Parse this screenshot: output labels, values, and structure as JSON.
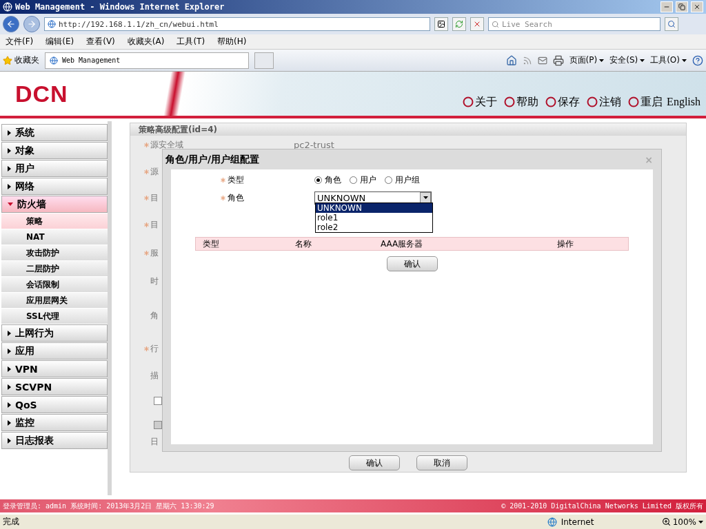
{
  "browser": {
    "title": "Web Management - Windows Internet Explorer",
    "address": "http://192.168.1.1/zh_cn/webui.html",
    "search_placeholder": "Live Search",
    "menu": [
      "文件(F)",
      "编辑(E)",
      "查看(V)",
      "收藏夹(A)",
      "工具(T)",
      "帮助(H)"
    ],
    "favorites": "收藏夹",
    "tab": "Web Management",
    "commands": [
      "页面(P)",
      "安全(S)",
      "工具(O)"
    ]
  },
  "header": {
    "logo": "DCN",
    "actions": [
      "关于",
      "帮助",
      "保存",
      "注销",
      "重启"
    ],
    "language": "English"
  },
  "sidebar": [
    {
      "label": "系统",
      "expanded": false
    },
    {
      "label": "对象",
      "expanded": false
    },
    {
      "label": "用户",
      "expanded": false
    },
    {
      "label": "网络",
      "expanded": false
    },
    {
      "label": "防火墙",
      "expanded": true,
      "children": [
        {
          "label": "策略",
          "selected": true
        },
        {
          "label": "NAT",
          "selected": false
        },
        {
          "label": "攻击防护",
          "selected": false
        },
        {
          "label": "二层防护",
          "selected": false
        },
        {
          "label": "会话限制",
          "selected": false
        },
        {
          "label": "应用层网关",
          "selected": false
        },
        {
          "label": "SSL代理",
          "selected": false
        }
      ]
    },
    {
      "label": "上网行为",
      "expanded": false
    },
    {
      "label": "应用",
      "expanded": false
    },
    {
      "label": "VPN",
      "expanded": false
    },
    {
      "label": "SCVPN",
      "expanded": false
    },
    {
      "label": "QoS",
      "expanded": false
    },
    {
      "label": "监控",
      "expanded": false
    },
    {
      "label": "日志报表",
      "expanded": false
    }
  ],
  "panel": {
    "title": "策略高级配置(id=4)",
    "fields": [
      {
        "kind": "text",
        "label": "源安全域",
        "required": true,
        "value": "pc2-trust"
      },
      {
        "kind": "text",
        "label": "源",
        "required": true
      },
      {
        "kind": "text",
        "label": "目",
        "required": true
      },
      {
        "kind": "text",
        "label": "目",
        "required": true
      },
      {
        "kind": "text",
        "label": "服",
        "required": true
      },
      {
        "kind": "text",
        "label": "时",
        "required": false
      },
      {
        "kind": "text",
        "label": "角",
        "required": false
      },
      {
        "kind": "text",
        "label": "行",
        "required": true
      },
      {
        "kind": "text",
        "label": "描",
        "required": false
      },
      {
        "kind": "checkbox",
        "checked": false,
        "disabled": false
      },
      {
        "kind": "checkbox",
        "checked": false,
        "disabled": true
      },
      {
        "kind": "text",
        "label": "日",
        "required": false
      }
    ],
    "buttons": [
      "确认",
      "取消"
    ]
  },
  "dialog": {
    "title": "角色/用户/用户组配置",
    "close": "×",
    "type_label": "类型",
    "type_options": [
      {
        "label": "角色",
        "selected": true
      },
      {
        "label": "用户",
        "selected": false
      },
      {
        "label": "用户组",
        "selected": false
      }
    ],
    "role_label": "角色",
    "role_value": "UNKNOWN",
    "role_options": [
      {
        "label": "UNKNOWN",
        "selected": true
      },
      {
        "label": "role1",
        "selected": false
      },
      {
        "label": "role2",
        "selected": false
      }
    ],
    "columns": [
      "类型",
      "名称",
      "AAA服务器",
      "操作"
    ],
    "confirm": "确认"
  },
  "footer": {
    "login": "登录管理员: admin 系统时间: 2013年3月2日 星期六 13:30:29",
    "copyright": "© 2001-2010 DigitalChina Networks Limited 版权所有"
  },
  "status_bar": {
    "text": "完成",
    "zone": "Internet",
    "zoom": "100%"
  }
}
